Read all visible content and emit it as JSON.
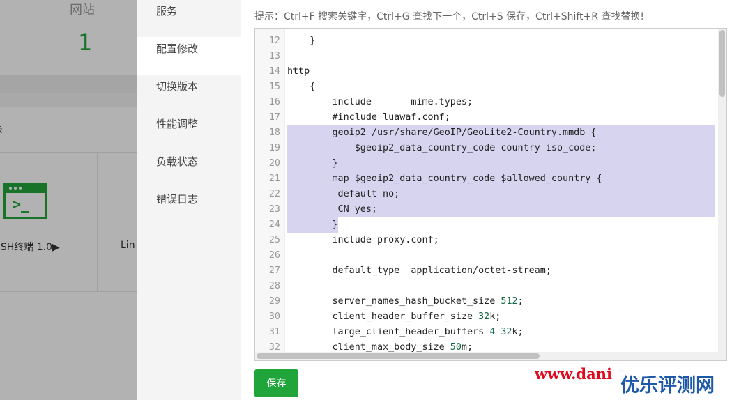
{
  "background": {
    "stat_label": "网站",
    "stat_value": "1",
    "partial_text": "表",
    "ssh_label": "SSH终端 1.0▶",
    "partial_label_2": "Lin"
  },
  "nav": {
    "items": [
      {
        "label": "服务"
      },
      {
        "label": "配置修改"
      },
      {
        "label": "切换版本"
      },
      {
        "label": "性能调整"
      },
      {
        "label": "负载状态"
      },
      {
        "label": "错误日志"
      }
    ]
  },
  "hint": "提示：Ctrl+F 搜索关键字，Ctrl+G 查找下一个，Ctrl+S 保存，Ctrl+Shift+R 查找替换!",
  "editor": {
    "lines": [
      {
        "n": "12",
        "text": "    }"
      },
      {
        "n": "13",
        "text": ""
      },
      {
        "n": "14",
        "text": "http"
      },
      {
        "n": "15",
        "text": "    {"
      },
      {
        "n": "16",
        "text": "        include       mime.types;"
      },
      {
        "n": "17",
        "text": "        #include luawaf.conf;"
      },
      {
        "n": "18",
        "text": "        geoip2 /usr/share/GeoIP/GeoLite2-Country.mmdb {"
      },
      {
        "n": "19",
        "text": "            $geoip2_data_country_code country iso_code;"
      },
      {
        "n": "20",
        "text": "        }"
      },
      {
        "n": "21",
        "text": "        map $geoip2_data_country_code $allowed_country {"
      },
      {
        "n": "22",
        "text": "         default no;"
      },
      {
        "n": "23",
        "text": "         CN yes;"
      },
      {
        "n": "24",
        "text": "        }"
      },
      {
        "n": "25",
        "text": "        include proxy.conf;"
      },
      {
        "n": "26",
        "text": ""
      },
      {
        "n": "27",
        "text": "        default_type  application/octet-stream;"
      },
      {
        "n": "28",
        "text": ""
      },
      {
        "n": "29",
        "text": "        server_names_hash_bucket_size 512;"
      },
      {
        "n": "30",
        "text": "        client_header_buffer_size 32k;"
      },
      {
        "n": "31",
        "text": "        large_client_header_buffers 4 32k;"
      },
      {
        "n": "32",
        "text": "        client_max_body_size 50m;"
      }
    ],
    "selected_lines": [
      "18",
      "19",
      "20",
      "21",
      "22",
      "23",
      "24"
    ]
  },
  "save_label": "保存",
  "watermark": {
    "url": "www.dani",
    "brand": "优乐评测网"
  }
}
